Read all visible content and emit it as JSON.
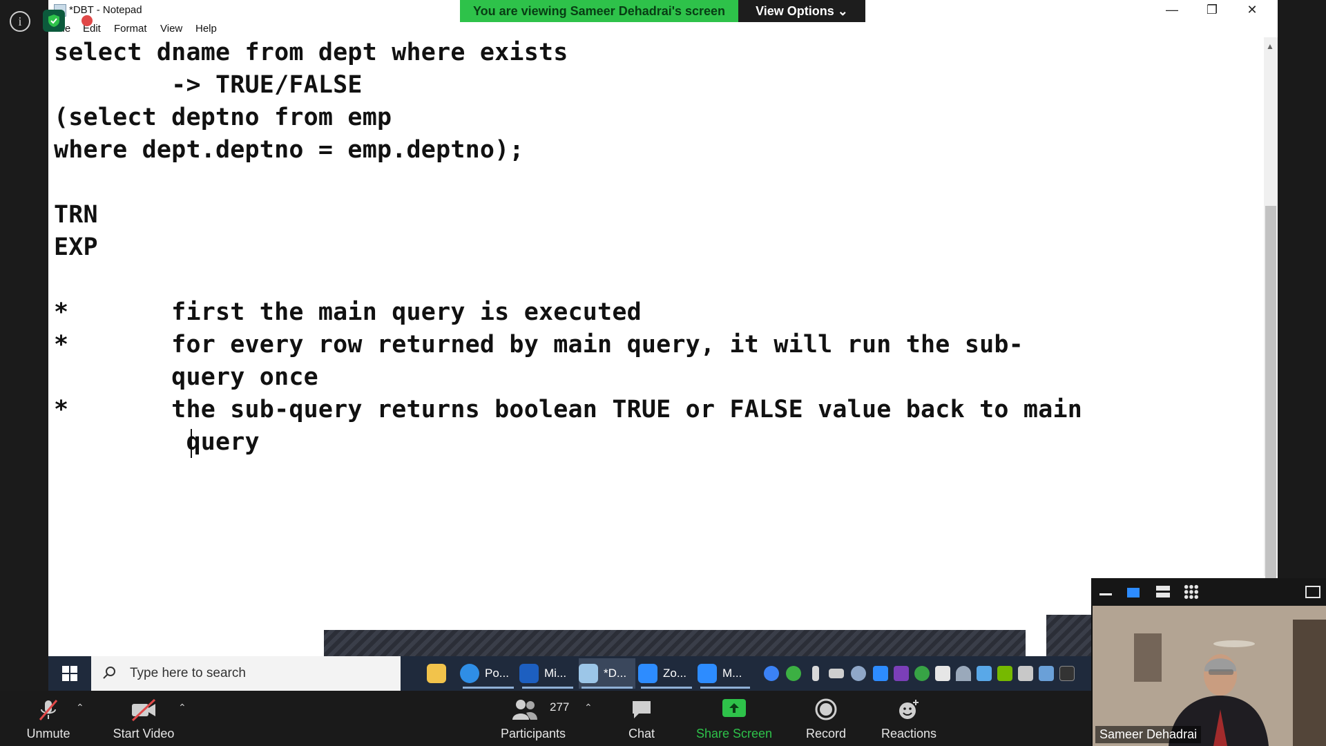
{
  "notepad": {
    "title": "*DBT - Notepad",
    "menu": [
      "File",
      "Edit",
      "Format",
      "View",
      "Help"
    ],
    "lines": [
      "select dname from dept where exists",
      "        -> TRUE/FALSE",
      "(select deptno from emp",
      "where dept.deptno = emp.deptno);",
      "",
      "TRN",
      "EXP",
      "",
      "*       first the main query is executed",
      "*       for every row returned by main query, it will run the sub-",
      "        query once",
      "*       the sub-query returns boolean TRUE or FALSE value back to main",
      "         query"
    ]
  },
  "banner": {
    "sharing_text": "You are viewing Sameer Dehadrai's screen",
    "view_options": "View Options ⌄"
  },
  "taskbar": {
    "search_placeholder": "Type here to search",
    "apps": [
      {
        "label": "Po...",
        "color": "#2f8ee6"
      },
      {
        "label": "Mi...",
        "color": "#1d5fc0"
      },
      {
        "label": "*D...",
        "color": "#9cc6e8"
      },
      {
        "label": "Zo...",
        "color": "#2d8cff"
      },
      {
        "label": "M...",
        "color": "#2d8cff"
      }
    ]
  },
  "zoom_controls": {
    "unmute": "Unmute",
    "start_video": "Start Video",
    "participants": "Participants",
    "participants_count": "277",
    "chat": "Chat",
    "share_screen": "Share Screen",
    "record": "Record",
    "reactions": "Reactions"
  },
  "video": {
    "participant_name": "Sameer Dehadrai"
  },
  "colors": {
    "banner_green": "#2ec24a",
    "share_green": "#2ec24a",
    "taskbar_bg": "#1f2a3c",
    "zoom_bg": "#1a1a1a"
  }
}
